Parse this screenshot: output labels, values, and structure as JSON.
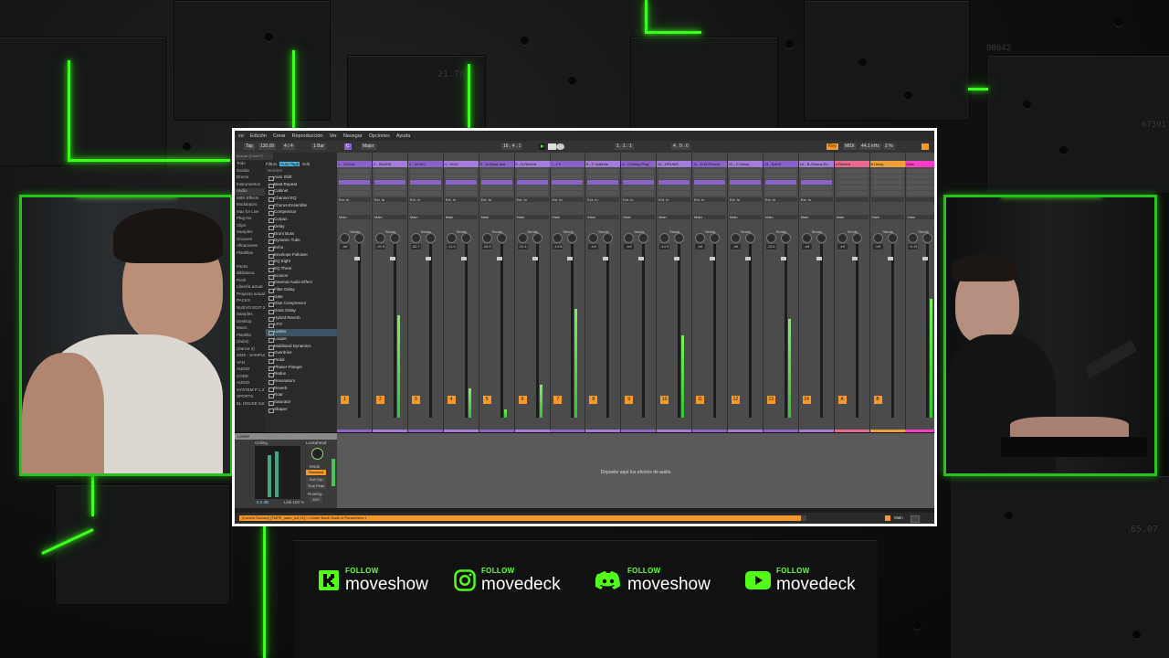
{
  "background": {
    "numbers": [
      "21.76",
      "98642",
      "67391",
      "65.07"
    ],
    "neon_color": "#3cff1e"
  },
  "daw": {
    "menu": [
      "vo",
      "Edición",
      "Crear",
      "Reproducción",
      "Ver",
      "Navegar",
      "Opciones",
      "Ayuda"
    ],
    "transport": {
      "tap": "Tap",
      "tempo": "130.00",
      "signature": "4 / 4",
      "quantize": "1 Bar",
      "key": "C",
      "scale": "Major",
      "position": "16 . 4 . 1",
      "loop_start": "1 . 1 . 1",
      "loop_len": "4 . 0 . 0",
      "key_label": "Key",
      "midi_label": "MIDI",
      "sample_rate": "44.1 kHz",
      "cpu": "2 %"
    },
    "browser": {
      "search_placeholder": "Buscar (Cmd+F)",
      "filters_label": "Filtros",
      "autotags_label": "Auto Tags",
      "edit_label": "Edit",
      "column_header": "Nombre",
      "places": [
        "Todo",
        "Sonido",
        "Drums",
        "Instrumentos",
        "Audio",
        "MIDI Effects",
        "Modulators",
        "Max for Live",
        "Plug-ins",
        "Clips",
        "Samples",
        "Grooves",
        "Afinaciones",
        "Plantillas",
        "",
        "Packs",
        "Biblioteca",
        "Push",
        "Librería actual",
        "Proyecto actual",
        "PACKS",
        "NUEVO EDIT 2C",
        "Samples",
        "Desktop",
        "Music",
        "Plantilla",
        "(Dubs)",
        "(Dance 2)",
        "2025 - SAMPLE",
        "VAN",
        "AUDIO",
        "CODE",
        "AUDIO",
        "SYSTEM P 1.3",
        "SPORTS",
        "EL HOUSE Sim"
      ],
      "items": [
        "Auto Shift",
        "Beat Repeat",
        "Cabinet",
        "Channel EQ",
        "Chorus-Ensemble",
        "Compressor",
        "Corpus",
        "Delay",
        "Drum Buss",
        "Dynamic Tube",
        "Echo",
        "Envelope Follower",
        "EQ Eight",
        "EQ Three",
        "Erosion",
        "External Audio Effect",
        "Filter Delay",
        "Gate",
        "Glue Compressor",
        "Grain Delay",
        "Hybrid Reverb",
        "LFO",
        "Limiter",
        "Looper",
        "Multiband Dynamics",
        "Overdrive",
        "Pedal",
        "Phaser-Flanger",
        "Redux",
        "Resonators",
        "Reverb",
        "Roar",
        "Saturator",
        "Shaper"
      ],
      "selected_item": "Limiter",
      "footer": "1 item selected"
    },
    "tracks": [
      {
        "name": "1 - VOCAL",
        "color": "#8a63c9",
        "volume": "-inf",
        "number": "1",
        "meter": 0
      },
      {
        "name": "2 - SNARE",
        "color": "#a47cd9",
        "volume": "-15.5",
        "number": "2",
        "meter": 0.62
      },
      {
        "name": "3 - MUSIC",
        "color": "#8a63c9",
        "volume": "-32.7",
        "number": "3",
        "meter": 0
      },
      {
        "name": "4 - KICK",
        "color": "#a47cd9",
        "volume": "-11.4",
        "number": "4",
        "meter": 0.18
      },
      {
        "name": "5 - W-Bass-Inst",
        "color": "#8a63c9",
        "volume": "-16.9",
        "number": "5",
        "meter": 0.05
      },
      {
        "name": "6 - B-Reverb",
        "color": "#a47cd9",
        "volume": "-10.4",
        "number": "6",
        "meter": 0.2
      },
      {
        "name": "7 - FX",
        "color": "#8a63c9",
        "volume": "-14.6",
        "number": "7",
        "meter": 0.66
      },
      {
        "name": "8 - F-Voltiride",
        "color": "#a47cd9",
        "volume": "-inf",
        "number": "8",
        "meter": 0
      },
      {
        "name": "9 - X-Delay Plug",
        "color": "#8a63c9",
        "volume": "-inf",
        "number": "9",
        "meter": 0
      },
      {
        "name": "10 - DRUMS",
        "color": "#a47cd9",
        "volume": "-14.3",
        "number": "10",
        "meter": 0.5
      },
      {
        "name": "11 - D-M Reverb",
        "color": "#8a63c9",
        "volume": "-inf",
        "number": "11",
        "meter": 0
      },
      {
        "name": "12 - C-Delay",
        "color": "#a47cd9",
        "volume": "-inf",
        "number": "12",
        "meter": 0
      },
      {
        "name": "13 - BASS",
        "color": "#8a63c9",
        "volume": "-13.1",
        "number": "13",
        "meter": 0.6
      },
      {
        "name": "14 - B-Chorus En",
        "color": "#a47cd9",
        "volume": "-inf",
        "number": "14",
        "meter": 0
      },
      {
        "name": "A Reverb",
        "color": "#e86b8f",
        "volume": "-inf",
        "number": "A",
        "meter": 0
      },
      {
        "name": "B Delay",
        "color": "#f0a03a",
        "volume": "-inf",
        "number": "B",
        "meter": 0
      },
      {
        "name": "Main",
        "color": "#ff3cc8",
        "volume": "-0.14",
        "number": "",
        "meter": 0.72
      }
    ],
    "io_ext_in": "Ext. In",
    "io_main": "Main",
    "sends_label": "Sends",
    "cue_out": "Cue Out",
    "cue_val": "1/2",
    "main_out": "Main Out",
    "main_val": "1/2",
    "device": {
      "name": "Limiter",
      "ceiling": "Ceiling",
      "ceiling_val": "0.0 dB",
      "lookahead": "Lookahead",
      "mode": "Mode",
      "mode_val": "Standard",
      "soft_clip": "Soft Clip",
      "true_peak": "True Peak",
      "routing": "Routing",
      "routing_val": "M/S",
      "link": "Link",
      "link_val": "100 %",
      "drop_text": "Deposite aquí los efectos de audio"
    },
    "status_text": "[Control Surface] [TMPE_nano_m4 01] > Limiter Bank: Bank of Parameters 1",
    "status_right": "Main"
  },
  "socials": [
    {
      "follow": "FOLLOW",
      "handle": "moveshow",
      "icon": "kick-icon",
      "color": "#53fc18"
    },
    {
      "follow": "FOLLOW",
      "handle": "movedeck",
      "icon": "instagram-icon",
      "color": "#53fc18"
    },
    {
      "follow": "FOLLOW",
      "handle": "moveshow",
      "icon": "discord-icon",
      "color": "#53fc18"
    },
    {
      "follow": "FOLLOW",
      "handle": "movedeck",
      "icon": "youtube-icon",
      "color": "#53fc18"
    }
  ]
}
